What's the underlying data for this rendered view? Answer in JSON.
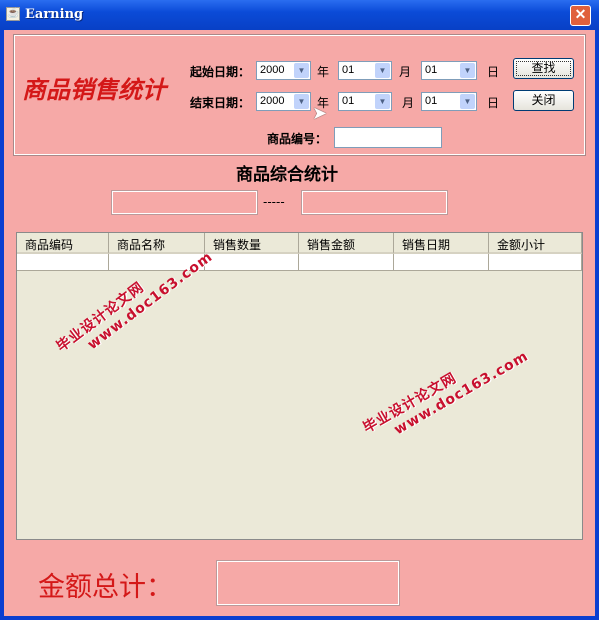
{
  "window": {
    "title": "Earning",
    "close": "✕"
  },
  "header": {
    "title": "商品销售统计"
  },
  "form": {
    "start_label": "起始日期：",
    "end_label": "结束日期：",
    "start": {
      "year": "2000",
      "month": "01",
      "day": "01"
    },
    "end": {
      "year": "2000",
      "month": "01",
      "day": "01"
    },
    "year_unit": "年",
    "month_unit": "月",
    "day_unit": "日",
    "product_code_label": "商品编号：",
    "product_code_value": ""
  },
  "buttons": {
    "search": "查找",
    "close": "关闭"
  },
  "summary": {
    "title": "商品综合统计",
    "separator": "-----",
    "from_value": "",
    "to_value": ""
  },
  "table": {
    "columns": [
      "商品编码",
      "商品名称",
      "销售数量",
      "销售金额",
      "销售日期",
      "金额小计"
    ],
    "rows": [
      [
        "",
        "",
        "",
        "",
        "",
        ""
      ]
    ]
  },
  "total": {
    "label": "金额总计：",
    "value": ""
  },
  "watermark": {
    "line1": "毕业设计论文网",
    "line2": "www.doc163.com"
  },
  "colors": {
    "background": "#f6a9a7",
    "title_red": "#d41818",
    "titlebar": "#0b4bd8"
  }
}
